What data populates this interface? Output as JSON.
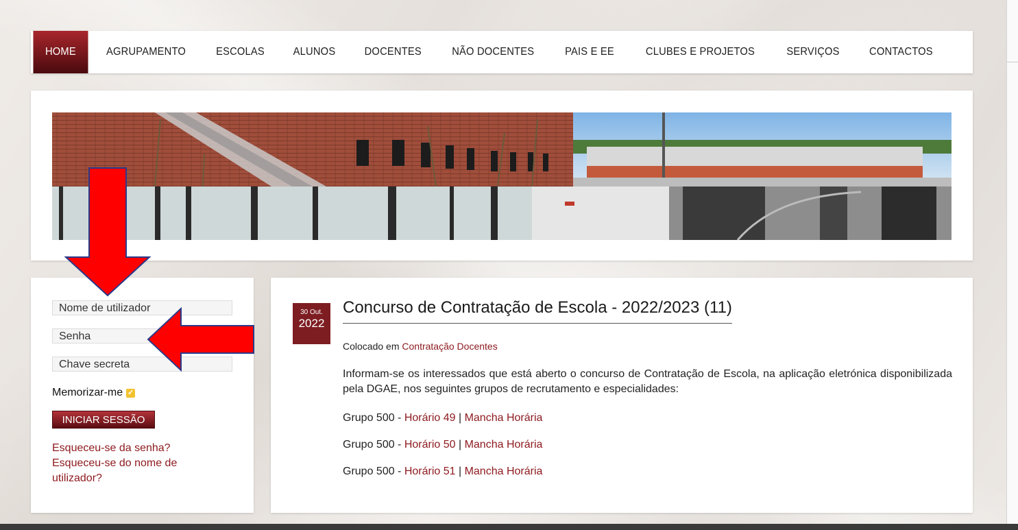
{
  "nav": {
    "items": [
      "HOME",
      "AGRUPAMENTO",
      "ESCOLAS",
      "ALUNOS",
      "DOCENTES",
      "NÃO DOCENTES",
      "PAIS E EE",
      "CLUBES E PROJETOS",
      "SERVIÇOS",
      "CONTACTOS"
    ],
    "active": "HOME"
  },
  "login": {
    "username_placeholder": "Nome de utilizador",
    "password_placeholder": "Senha",
    "secret_placeholder": "Chave secreta",
    "remember_label": "Memorizar-me",
    "remember_checked": true,
    "submit_label": "INICIAR SESSÃO",
    "forgot_password": "Esqueceu-se da senha?",
    "forgot_username": "Esqueceu-se do nome de utilizador?"
  },
  "article": {
    "date_day_month": "30 Out.",
    "date_year": "2022",
    "title": "Concurso de Contratação de Escola - 2022/2023 (11)",
    "posted_prefix": "Colocado em",
    "category": "Contratação Docentes",
    "body": "Informam-se os interessados que está aberto o concurso de Contratação de Escola, na aplicação eletrónica disponibilizada pela DGAE, nos seguintes grupos de recrutamento e especialidades:",
    "grupos": [
      {
        "prefix": "Grupo 500 - ",
        "horario": "Horário 49",
        "sep": " | ",
        "mancha": "Mancha Horária"
      },
      {
        "prefix": "Grupo 500 - ",
        "horario": "Horário 50",
        "sep": " | ",
        "mancha": "Mancha Horária"
      },
      {
        "prefix": "Grupo 500 - ",
        "horario": "Horário 51",
        "sep": " | ",
        "mancha": "Mancha Horária"
      }
    ]
  },
  "colors": {
    "accent": "#7d1d22",
    "link": "#8e1b20",
    "arrow": "#ff0000",
    "checkbox": "#f2c230"
  }
}
